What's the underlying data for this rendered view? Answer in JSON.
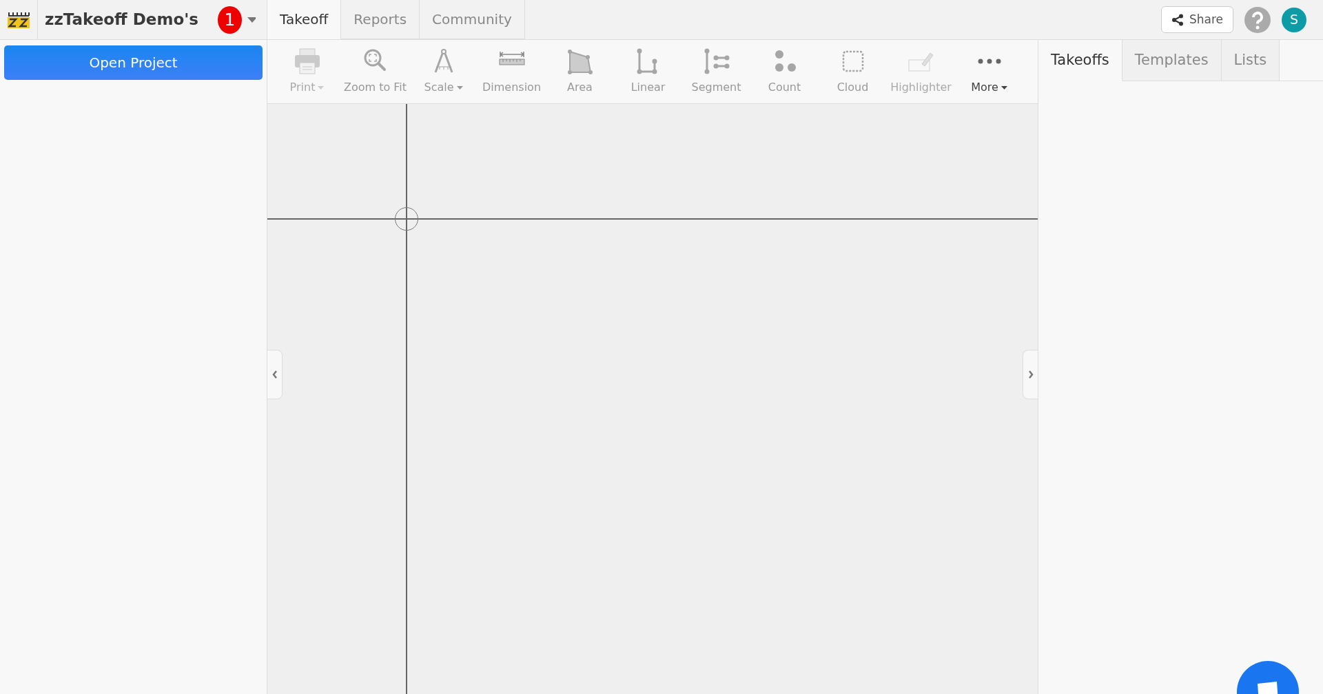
{
  "header": {
    "project_name": "zzTakeoff Demo's",
    "notification_count": "1"
  },
  "main_tabs": [
    {
      "label": "Takeoff",
      "selected": true
    },
    {
      "label": "Reports",
      "selected": false
    },
    {
      "label": "Community",
      "selected": false
    }
  ],
  "header_actions": {
    "share_label": "Share",
    "avatar_initial": "S"
  },
  "sidebar": {
    "open_project_label": "Open Project"
  },
  "toolbar": [
    {
      "kind": "print",
      "label": "Print",
      "dropdown": true,
      "disabled": true
    },
    {
      "kind": "zoom",
      "label": "Zoom to Fit",
      "dropdown": false,
      "disabled": false
    },
    {
      "kind": "scale",
      "label": "Scale",
      "dropdown": true,
      "disabled": false
    },
    {
      "kind": "dimension",
      "label": "Dimension",
      "dropdown": false,
      "disabled": false
    },
    {
      "kind": "area",
      "label": "Area",
      "dropdown": false,
      "disabled": false
    },
    {
      "kind": "linear",
      "label": "Linear",
      "dropdown": false,
      "disabled": false
    },
    {
      "kind": "segment",
      "label": "Segment",
      "dropdown": false,
      "disabled": false
    },
    {
      "kind": "count",
      "label": "Count",
      "dropdown": false,
      "disabled": false
    },
    {
      "kind": "cloud",
      "label": "Cloud",
      "dropdown": false,
      "disabled": false
    },
    {
      "kind": "highlighter",
      "label": "Highlighter",
      "dropdown": false,
      "disabled": true
    },
    {
      "kind": "more",
      "label": "More",
      "dropdown": true,
      "disabled": false
    }
  ],
  "panel_tabs": [
    {
      "label": "Takeoffs",
      "selected": true
    },
    {
      "label": "Templates",
      "selected": false
    },
    {
      "label": "Lists",
      "selected": false
    }
  ]
}
